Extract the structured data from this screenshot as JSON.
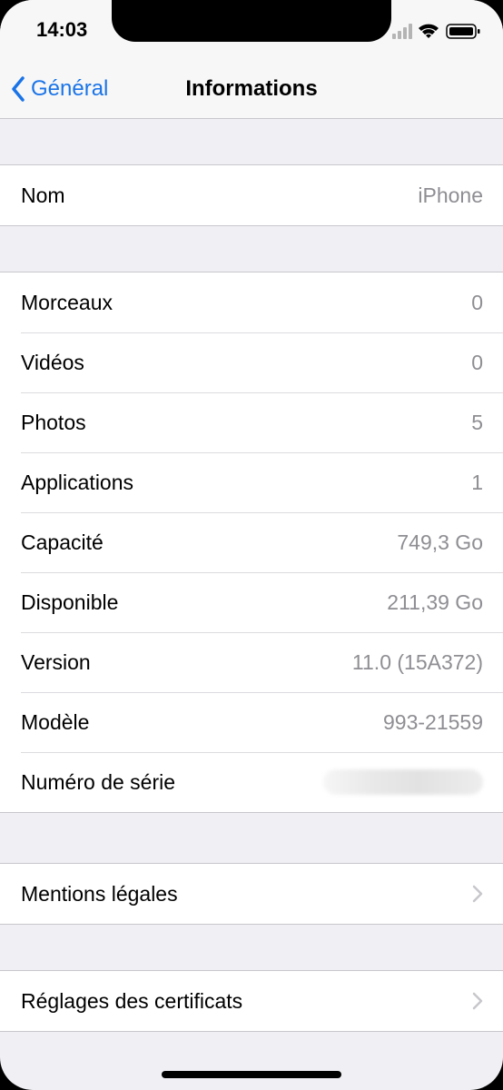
{
  "status_bar": {
    "time": "14:03"
  },
  "nav": {
    "back_label": "Général",
    "title": "Informations"
  },
  "group_name": [
    {
      "label": "Nom",
      "value": "iPhone"
    }
  ],
  "group_info": [
    {
      "label": "Morceaux",
      "value": "0"
    },
    {
      "label": "Vidéos",
      "value": "0"
    },
    {
      "label": "Photos",
      "value": "5"
    },
    {
      "label": "Applications",
      "value": "1"
    },
    {
      "label": "Capacité",
      "value": "749,3 Go"
    },
    {
      "label": "Disponible",
      "value": "211,39 Go"
    },
    {
      "label": "Version",
      "value": "11.0 (15A372)"
    },
    {
      "label": "Modèle",
      "value": "993-21559"
    },
    {
      "label": "Numéro de série",
      "value": null
    }
  ],
  "group_links": [
    {
      "label": "Mentions légales"
    },
    {
      "label": "Réglages des certificats"
    }
  ],
  "colors": {
    "accent": "#1a74e8",
    "secondary_text": "#8e8e93",
    "background": "#efeff4"
  }
}
